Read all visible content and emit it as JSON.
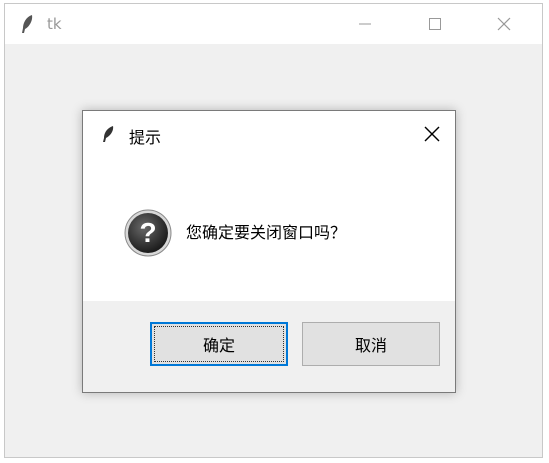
{
  "main_window": {
    "title": "tk",
    "controls": {
      "minimize_icon": "minimize-icon",
      "maximize_icon": "maximize-icon",
      "close_icon": "close-icon"
    }
  },
  "dialog": {
    "title": "提示",
    "message": "您确定要关闭窗口吗？",
    "icon": "question-icon",
    "buttons": {
      "ok": "确定",
      "cancel": "取消"
    }
  },
  "colors": {
    "window_bg": "#f0f0f0",
    "focus_border": "#0078d7",
    "button_bg": "#e1e1e1"
  }
}
